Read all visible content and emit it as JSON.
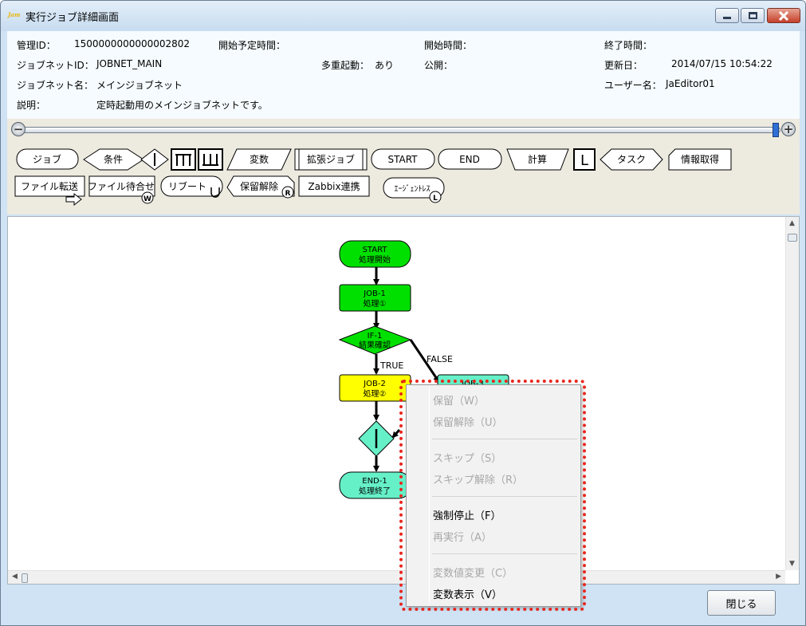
{
  "window": {
    "icon_text": "Jam",
    "title": "実行ジョブ詳細画面"
  },
  "info": {
    "manage_id_label": "管理ID：",
    "manage_id_value": "1500000000000002802",
    "scheduled_start_label": "開始予定時間：",
    "start_time_label": "開始時間：",
    "end_time_label": "終了時間：",
    "jobnet_id_label": "ジョブネットID：",
    "jobnet_id_value": "JOBNET_MAIN",
    "multi_start_label": "多重起動：",
    "multi_start_value": "あり",
    "public_label": "公開：",
    "updated_label": "更新日：",
    "updated_value": "2014/07/15 10:54:22",
    "jobnet_name_label": "ジョブネット名：",
    "jobnet_name_value": "メインジョブネット",
    "user_name_label": "ユーザー名：",
    "user_name_value": "JaEditor01",
    "description_label": "説明：",
    "description_value": "定時起動用のメインジョブネットです。"
  },
  "zoom": {
    "out_symbol": "−",
    "in_symbol": "+",
    "level_fraction": 1.0
  },
  "palette": {
    "job": "ジョブ",
    "condition": "条件",
    "parallel_start": "",
    "parallel_end": "",
    "variable": "変数",
    "extended_job": "拡張ジョブ",
    "start": "START",
    "end": "END",
    "calc": "計算",
    "loop": "L",
    "task": "タスク",
    "info_get": "情報取得",
    "file_transfer": "ファイル転送",
    "file_wait": "ファイル待合せ",
    "reboot": "リブート",
    "hold_release": "保留解除",
    "zabbix": "Zabbix連携",
    "agentless": "ｴｰｼﾞｪﾝﾄﾚｽ",
    "badge_w": "W",
    "badge_r": "R",
    "badge_l": "L"
  },
  "flow": {
    "start": {
      "line1": "START",
      "line2": "処理開始",
      "color": "#00e000"
    },
    "job1": {
      "line1": "JOB-1",
      "line2": "処理①",
      "color": "#00e000"
    },
    "if1": {
      "line1": "IF-1",
      "line2": "結果確認",
      "color": "#00e000"
    },
    "job2": {
      "line1": "JOB-2",
      "line2": "処理②",
      "color": "#ffff00"
    },
    "job3": {
      "line1": "JOB-3",
      "color": "#66f0c8"
    },
    "merge": {
      "color": "#66f0c8"
    },
    "end1": {
      "line1": "END-1",
      "line2": "処理終了",
      "color": "#66f0c8"
    },
    "true_label": "TRUE",
    "false_label": "FALSE"
  },
  "context_menu": {
    "hold": "保留（W）",
    "hold_release": "保留解除（U）",
    "skip": "スキップ（S）",
    "skip_release": "スキップ解除（R）",
    "force_stop": "強制停止（F）",
    "rerun": "再実行（A）",
    "var_change": "変数値変更（C）",
    "var_show": "変数表示（V）"
  },
  "buttons": {
    "close": "閉じる"
  }
}
